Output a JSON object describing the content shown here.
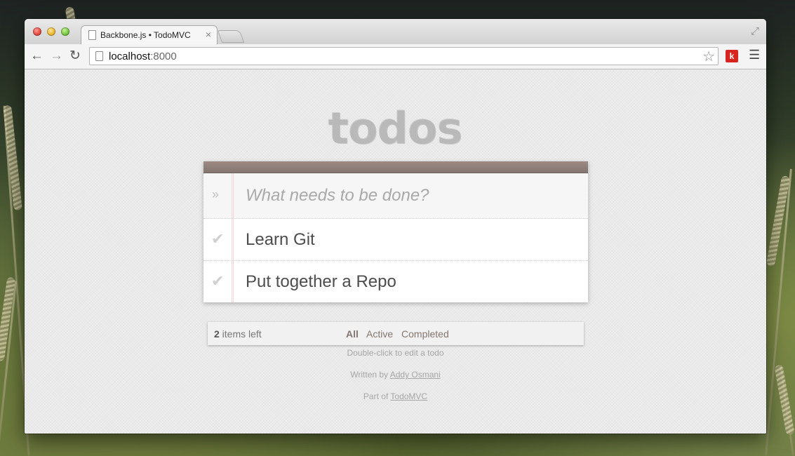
{
  "browser": {
    "tab_title": "Backbone.js • TodoMVC",
    "tab_close": "×",
    "url_host": "localhost",
    "url_port": ":8000",
    "extension_label": "k"
  },
  "app": {
    "title": "todos",
    "new_todo_placeholder": "What needs to be done?",
    "todos": [
      {
        "label": "Learn Git",
        "completed": false
      },
      {
        "label": "Put together a Repo",
        "completed": false
      }
    ],
    "footer": {
      "count": "2",
      "count_suffix": " items left",
      "filters": [
        "All",
        "Active",
        "Completed"
      ],
      "selected_filter": "All"
    }
  },
  "info": {
    "hint": "Double-click to edit a todo",
    "written_by_prefix": "Written by ",
    "author": "Addy Osmani",
    "part_of_prefix": "Part of ",
    "project": "TodoMVC"
  },
  "icons": {
    "back": "back-arrow-icon",
    "forward": "forward-arrow-icon",
    "reload": "reload-icon",
    "star": "star-icon",
    "menu": "menu-icon",
    "fullscreen": "fullscreen-icon",
    "check": "check-icon",
    "toggle_all": "chevron-down-icon"
  },
  "colors": {
    "header_bar": "#8f7f78",
    "filter_link": "#83756f",
    "extension_red": "#d8241f"
  }
}
